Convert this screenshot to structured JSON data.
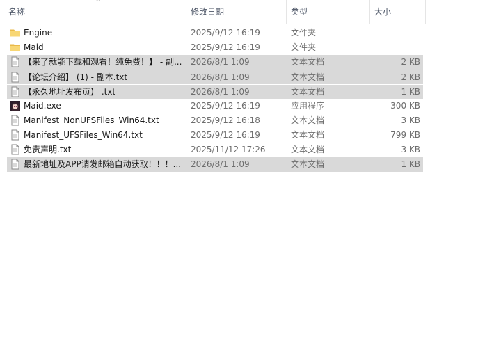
{
  "columns": {
    "name": "名称",
    "date": "修改日期",
    "type": "类型",
    "size": "大小"
  },
  "files": [
    {
      "name": "Engine",
      "date": "2025/9/12 16:19",
      "type": "文件夹",
      "size": "",
      "icon": "folder-icon",
      "selected": false
    },
    {
      "name": "Maid",
      "date": "2025/9/12 16:19",
      "type": "文件夹",
      "size": "",
      "icon": "folder-icon",
      "selected": false
    },
    {
      "name": "【来了就能下载和观看！纯免费！】 - 副...",
      "date": "2026/8/1 1:09",
      "type": "文本文档",
      "size": "2 KB",
      "icon": "text-file-icon",
      "selected": true
    },
    {
      "name": "【论坛介绍】 (1) - 副本.txt",
      "date": "2026/8/1 1:09",
      "type": "文本文档",
      "size": "2 KB",
      "icon": "text-file-icon",
      "selected": true
    },
    {
      "name": "【永久地址发布页】 .txt",
      "date": "2026/8/1 1:09",
      "type": "文本文档",
      "size": "1 KB",
      "icon": "text-file-icon",
      "selected": true
    },
    {
      "name": "Maid.exe",
      "date": "2025/9/12 16:19",
      "type": "应用程序",
      "size": "300 KB",
      "icon": "app-icon",
      "selected": false
    },
    {
      "name": "Manifest_NonUFSFiles_Win64.txt",
      "date": "2025/9/12 16:18",
      "type": "文本文档",
      "size": "3 KB",
      "icon": "text-file-icon",
      "selected": false
    },
    {
      "name": "Manifest_UFSFiles_Win64.txt",
      "date": "2025/9/12 16:19",
      "type": "文本文档",
      "size": "799 KB",
      "icon": "text-file-icon",
      "selected": false
    },
    {
      "name": "免责声明.txt",
      "date": "2025/11/12 17:26",
      "type": "文本文档",
      "size": "3 KB",
      "icon": "text-file-icon",
      "selected": false
    },
    {
      "name": "最新地址及APP请发邮箱自动获取！！！...",
      "date": "2026/8/1 1:09",
      "type": "文本文档",
      "size": "1 KB",
      "icon": "text-file-icon",
      "selected": true
    }
  ],
  "colors": {
    "selection": "#d9d9d9",
    "folder": "#f8d775",
    "header_text": "#4c5566"
  }
}
